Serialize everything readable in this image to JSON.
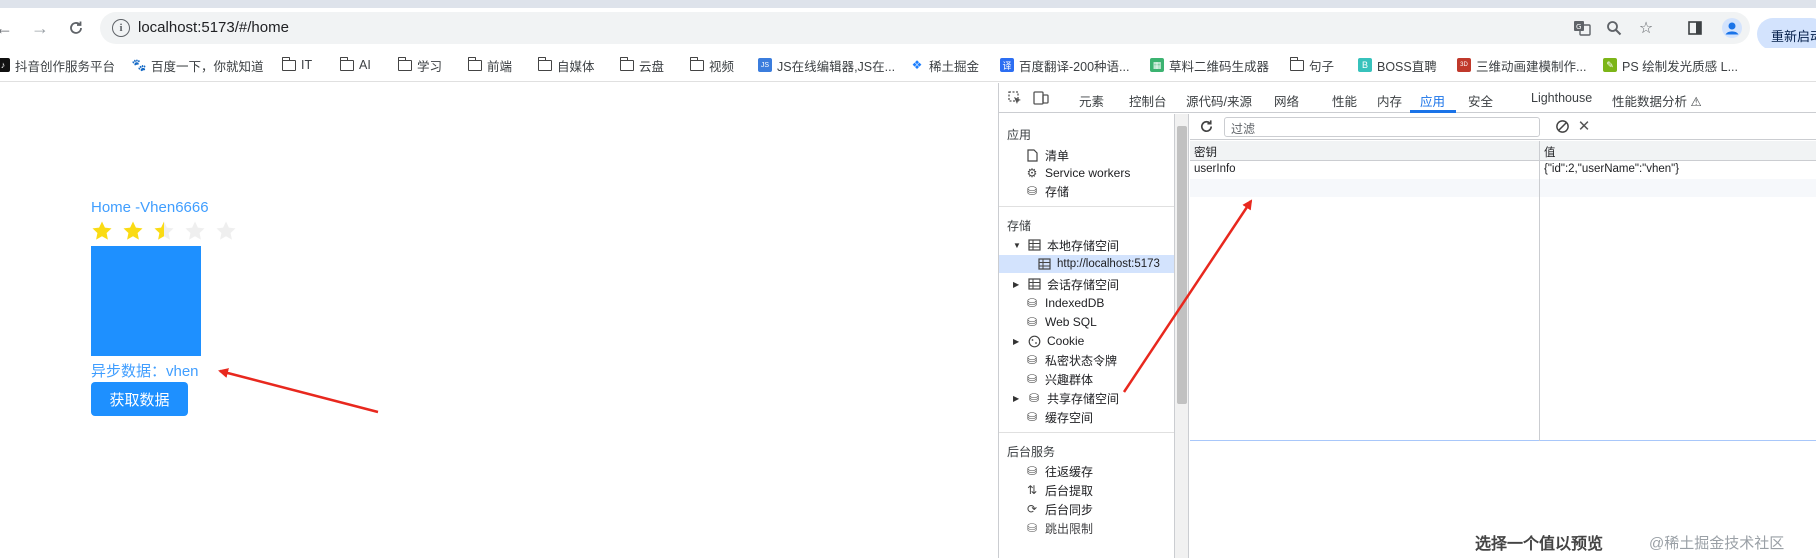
{
  "browser": {
    "url": "localhost:5173/#/home",
    "restart_label": "重新启动",
    "bookmarks": [
      {
        "label": "抖音创作服务平台",
        "icon": "douyin-icon"
      },
      {
        "label": "百度一下，你就知道",
        "icon": "baidu-icon"
      },
      {
        "label": "IT",
        "icon": "folder-icon"
      },
      {
        "label": "AI",
        "icon": "folder-icon"
      },
      {
        "label": "学习",
        "icon": "folder-icon"
      },
      {
        "label": "前端",
        "icon": "folder-icon"
      },
      {
        "label": "自媒体",
        "icon": "folder-icon"
      },
      {
        "label": "云盘",
        "icon": "folder-icon"
      },
      {
        "label": "视频",
        "icon": "folder-icon"
      },
      {
        "label": "JS在线编辑器,JS在...",
        "icon": "jseditor-icon"
      },
      {
        "label": "稀土掘金",
        "icon": "juejin-icon"
      },
      {
        "label": "百度翻译-200种语...",
        "icon": "baidu-translate-icon"
      },
      {
        "label": "草料二维码生成器",
        "icon": "qrcode-icon"
      },
      {
        "label": "句子",
        "icon": "folder-icon"
      },
      {
        "label": "BOSS直聘",
        "icon": "boss-icon"
      },
      {
        "label": "三维动画建模制作...",
        "icon": "3d-icon"
      },
      {
        "label": "PS 绘制发光质感 L...",
        "icon": "ps-icon"
      }
    ]
  },
  "app": {
    "title": "Home -Vhen6666",
    "rating": 2.5,
    "rating_max": 5,
    "async_text": "异步数据：vhen",
    "fetch_button": "获取数据",
    "box_color": "#1e90ff"
  },
  "devtools": {
    "tabs": [
      "元素",
      "控制台",
      "源代码/来源",
      "网络",
      "性能",
      "内存",
      "应用",
      "安全",
      "Lighthouse",
      "性能数据分析 ⚠"
    ],
    "active_tab": "应用",
    "sidebar": {
      "section_app": "应用",
      "app_items": [
        "清单",
        "Service workers",
        "存储"
      ],
      "section_storage": "存储",
      "storage_items": [
        "本地存储空间",
        "http://localhost:5173",
        "会话存储空间",
        "IndexedDB",
        "Web SQL",
        "Cookie",
        "私密状态令牌",
        "兴趣群体",
        "共享存储空间",
        "缓存空间"
      ],
      "section_bg": "后台服务",
      "bg_items": [
        "往返缓存",
        "后台提取",
        "后台同步",
        "跳出限制"
      ]
    },
    "filter_placeholder": "过滤",
    "table": {
      "col_key": "密钥",
      "col_value": "值",
      "rows": [
        {
          "key": "userInfo",
          "value": "{\"id\":2,\"userName\":\"vhen\"}"
        }
      ]
    },
    "preview_text": "选择一个值以预览"
  },
  "watermark": "@稀土掘金技术社区",
  "colors": {
    "accent": "#1a73e8",
    "app_blue": "#409eff",
    "arrow_red": "#e8281e",
    "star_gold": "#fadb14"
  }
}
